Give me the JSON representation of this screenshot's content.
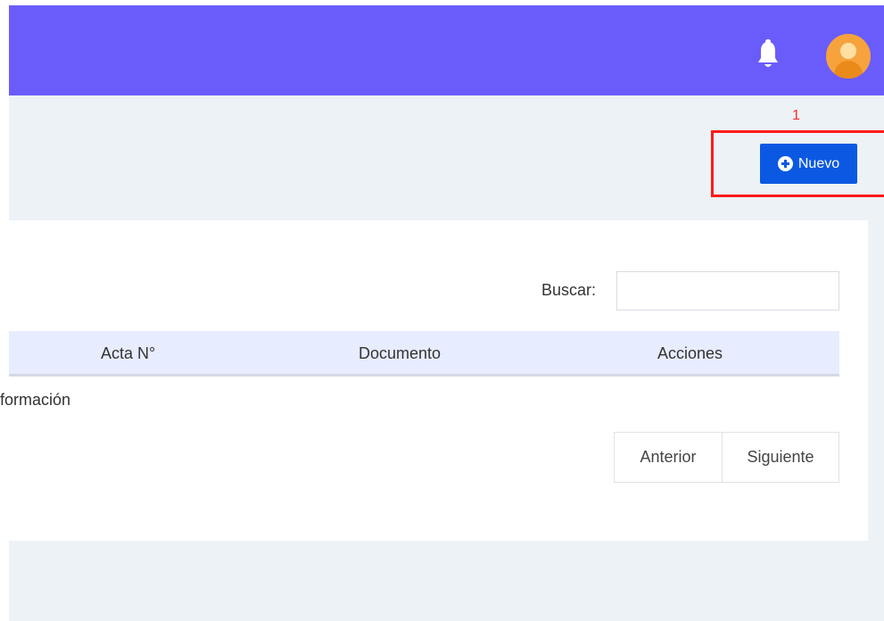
{
  "header": {
    "bell_icon": "bell-icon",
    "avatar_icon": "user-avatar"
  },
  "annotation": {
    "number": "1",
    "color": "#ff1a1a"
  },
  "toolbar": {
    "new_label": "Nuevo",
    "new_icon": "plus-circle-icon"
  },
  "search": {
    "label": "Buscar:",
    "value": ""
  },
  "table": {
    "columns": [
      "Acta N°",
      "Documento",
      "Acciones"
    ],
    "empty_message": "formación"
  },
  "pagination": {
    "previous": "Anterior",
    "next": "Siguiente"
  },
  "colors": {
    "header": "#6a5cfb",
    "button": "#0b59e3",
    "content_bg": "#edf2f7",
    "table_header": "#e7ecff"
  }
}
